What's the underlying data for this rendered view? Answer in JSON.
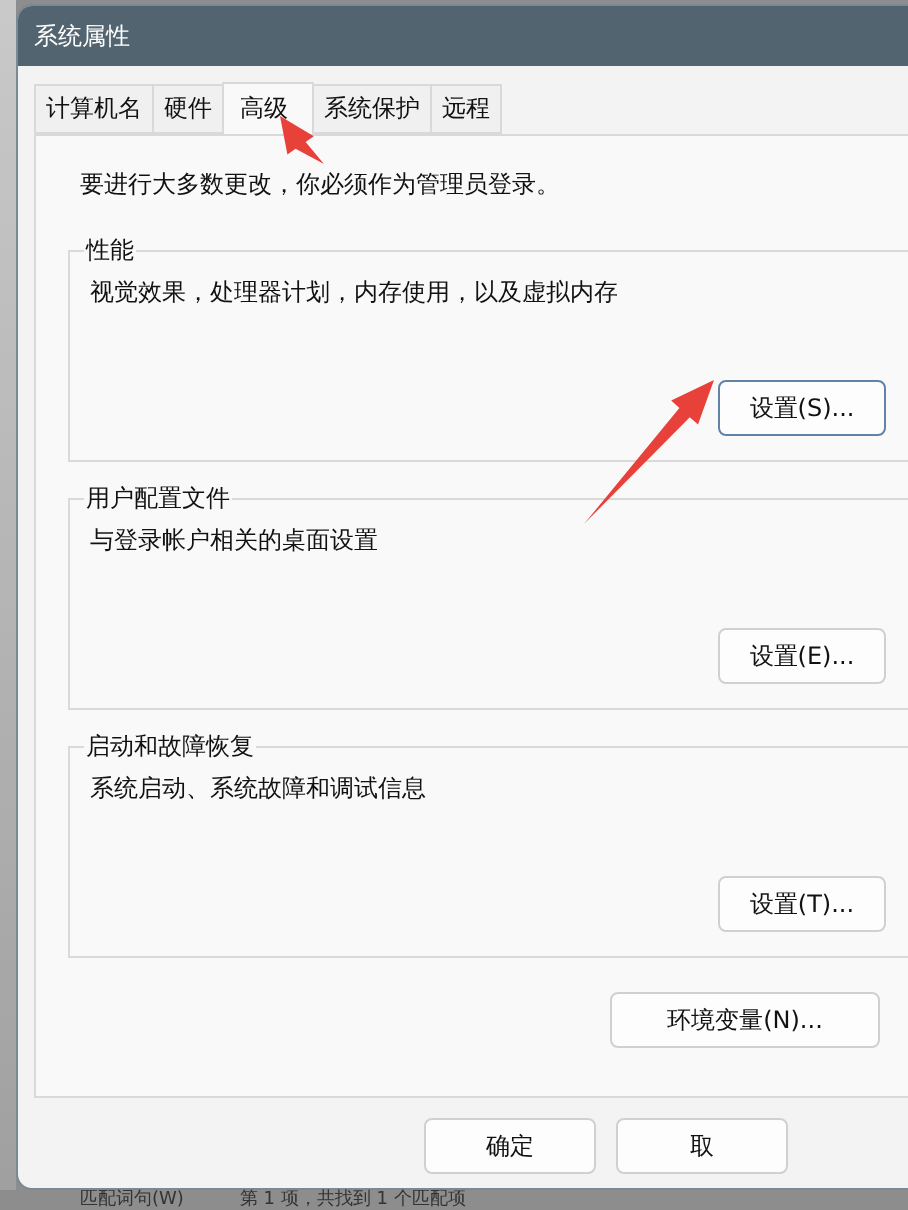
{
  "window": {
    "title": "系统属性"
  },
  "tabs": [
    {
      "label": "计算机名",
      "selected": false
    },
    {
      "label": "硬件",
      "selected": false
    },
    {
      "label": "高级",
      "selected": true
    },
    {
      "label": "系统保护",
      "selected": false
    },
    {
      "label": "远程",
      "selected": false
    }
  ],
  "notice": "要进行大多数更改，你必须作为管理员登录。",
  "groups": [
    {
      "title": "性能",
      "description": "视觉效果，处理器计划，内存使用，以及虚拟内存",
      "button": "设置(S)...",
      "focused": true
    },
    {
      "title": "用户配置文件",
      "description": "与登录帐户相关的桌面设置",
      "button": "设置(E)...",
      "focused": false
    },
    {
      "title": "启动和故障恢复",
      "description": "系统启动、系统故障和调试信息",
      "button": "设置(T)...",
      "focused": false
    }
  ],
  "env_button": "环境变量(N)...",
  "footer_buttons": [
    {
      "label": "确定"
    },
    {
      "label": "取"
    }
  ],
  "background_bar": {
    "items": [
      "匹配词句(W)",
      "第 1 项，共找到 1 个匹配项"
    ]
  }
}
